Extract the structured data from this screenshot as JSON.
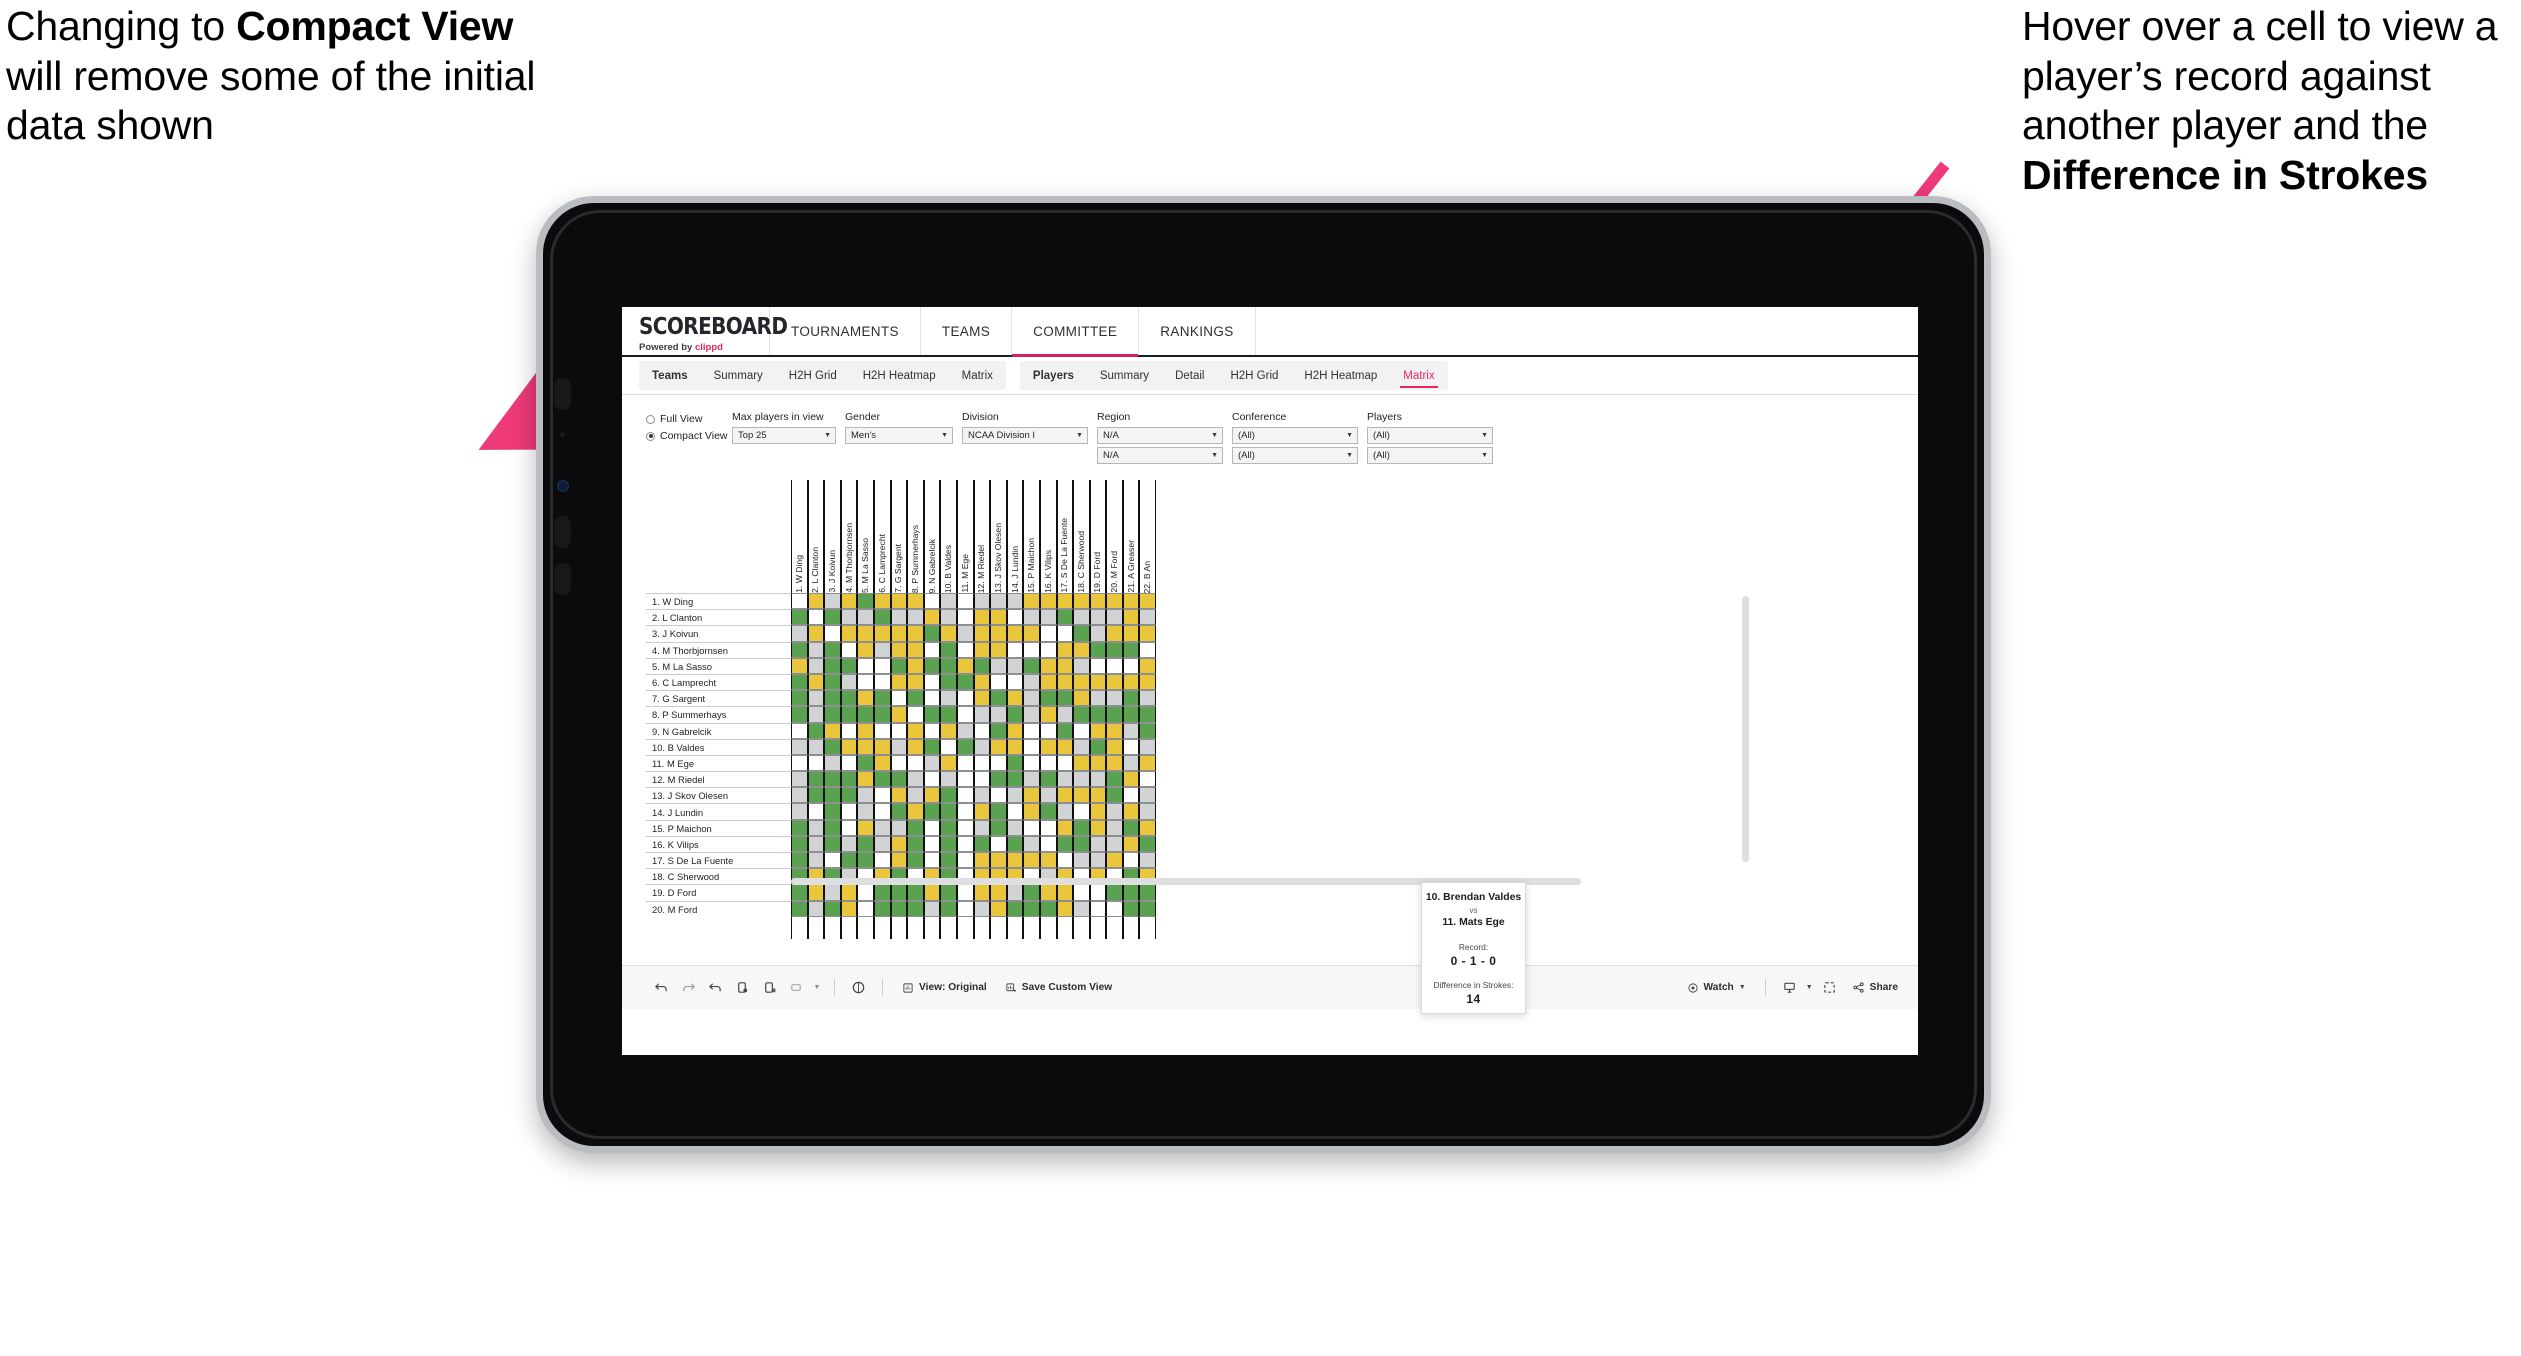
{
  "annotations": {
    "left": {
      "line1": "Changing to ",
      "bold": "Compact View",
      "line2": " will remove some of the initial data shown"
    },
    "right": {
      "line1": "Hover over a cell to view a player’s record against another player and the ",
      "bold": "Difference in Strokes"
    },
    "arrow_color": "#ee3a78"
  },
  "app": {
    "logo": {
      "word": "SCOREBOARD",
      "powered_prefix": "Powered by ",
      "brand": "clippd"
    },
    "top_tabs": [
      {
        "label": "TOURNAMENTS",
        "active": false
      },
      {
        "label": "TEAMS",
        "active": false
      },
      {
        "label": "COMMITTEE",
        "active": true
      },
      {
        "label": "RANKINGS",
        "active": false
      }
    ],
    "sub_tabs_group1": [
      {
        "label": "Teams",
        "active": false,
        "bold": true
      },
      {
        "label": "Summary",
        "active": false,
        "bold": false
      },
      {
        "label": "H2H Grid",
        "active": false,
        "bold": false
      },
      {
        "label": "H2H Heatmap",
        "active": false,
        "bold": false
      },
      {
        "label": "Matrix",
        "active": false,
        "bold": false
      }
    ],
    "sub_tabs_group2": [
      {
        "label": "Players",
        "active": false,
        "bold": true
      },
      {
        "label": "Summary",
        "active": false,
        "bold": false
      },
      {
        "label": "Detail",
        "active": false,
        "bold": false
      },
      {
        "label": "H2H Grid",
        "active": false,
        "bold": false
      },
      {
        "label": "H2H Heatmap",
        "active": false,
        "bold": false
      },
      {
        "label": "Matrix",
        "active": true,
        "bold": false
      }
    ]
  },
  "filters": {
    "view_modes": [
      {
        "label": "Full View",
        "selected": false
      },
      {
        "label": "Compact View",
        "selected": true
      }
    ],
    "fields": [
      {
        "label": "Max players in view",
        "value": "Top 25",
        "second": null
      },
      {
        "label": "Gender",
        "value": "Men's",
        "second": null
      },
      {
        "label": "Division",
        "value": "NCAA Division I",
        "second": null
      },
      {
        "label": "Region",
        "value": "N/A",
        "second": "N/A"
      },
      {
        "label": "Conference",
        "value": "(All)",
        "second": "(All)"
      },
      {
        "label": "Players",
        "value": "(All)",
        "second": "(All)"
      }
    ]
  },
  "tooltip": {
    "player_a": "10. Brendan Valdes",
    "vs": "vs",
    "player_b": "11. Mats Ege",
    "record_label": "Record:",
    "record_value": "0 - 1 - 0",
    "diff_label": "Difference in Strokes:",
    "diff_value": "14"
  },
  "toolbar": {
    "icons": [
      "undo-icon",
      "redo-icon",
      "revert-icon",
      "refresh-data-icon",
      "pause-icon",
      "rectangle-select-icon",
      "dropdown-caret-icon"
    ],
    "help_icon": "help-icon",
    "view_original": "View: Original",
    "save_custom_view": "Save Custom View",
    "watch": "Watch",
    "share": "Share",
    "device_icon": "device-icon",
    "fullscreen_icon": "fullscreen-icon"
  },
  "chart_data": {
    "type": "heatmap",
    "title": "Head-to-Head Player Matrix",
    "legend": {
      "green": "#5aa24f",
      "yellow": "#e9c63c",
      "gray": "#d2d3d5",
      "white": "#ffffff"
    },
    "row_labels": [
      "1. W Ding",
      "2. L Clanton",
      "3. J Koivun",
      "4. M Thorbjornsen",
      "5. M La Sasso",
      "6. C Lamprecht",
      "7. G Sargent",
      "8. P Summerhays",
      "9. N Gabrelcik",
      "10. B Valdes",
      "11. M Ege",
      "12. M Riedel",
      "13. J Skov Olesen",
      "14. J Lundin",
      "15. P Maichon",
      "16. K Vilips",
      "17. S De La Fuente",
      "18. C Sherwood",
      "19. D Ford",
      "20. M Ford"
    ],
    "col_labels": [
      "1. W Ding",
      "2. L Clanton",
      "3. J Koivun",
      "4. M Thorbjornsen",
      "5. M La Sasso",
      "6. C Lamprecht",
      "7. G Sargent",
      "8. P Summerhays",
      "9. N Gabrelcik",
      "10. B Valdes",
      "11. M Ege",
      "12. M Riedel",
      "13. J Skov Olesen",
      "14. J Lundin",
      "15. P Maichon",
      "16. K Vilips",
      "17. S De La Fuente",
      "18. C Sherwood",
      "19. D Ford",
      "20. M Ford",
      "21. A Greaser",
      "22. B An"
    ],
    "cells": [
      [
        "w",
        "y",
        "a",
        "y",
        "g",
        "y",
        "y",
        "y",
        "w",
        "a",
        "w",
        "a",
        "a",
        "a",
        "y",
        "y",
        "y",
        "y",
        "y",
        "y",
        "y",
        "y"
      ],
      [
        "g",
        "w",
        "g",
        "a",
        "a",
        "g",
        "a",
        "a",
        "y",
        "a",
        "w",
        "y",
        "y",
        "w",
        "a",
        "a",
        "g",
        "a",
        "a",
        "a",
        "y",
        "a"
      ],
      [
        "a",
        "y",
        "w",
        "y",
        "y",
        "y",
        "y",
        "y",
        "g",
        "y",
        "a",
        "y",
        "y",
        "y",
        "y",
        "w",
        "w",
        "g",
        "a",
        "y",
        "y",
        "y"
      ],
      [
        "g",
        "a",
        "g",
        "w",
        "y",
        "a",
        "y",
        "y",
        "w",
        "g",
        "w",
        "y",
        "y",
        "w",
        "w",
        "w",
        "y",
        "y",
        "g",
        "g",
        "g",
        "w"
      ],
      [
        "y",
        "a",
        "g",
        "g",
        "w",
        "w",
        "g",
        "y",
        "g",
        "g",
        "y",
        "g",
        "a",
        "a",
        "g",
        "y",
        "y",
        "a",
        "w",
        "w",
        "w",
        "y"
      ],
      [
        "g",
        "y",
        "g",
        "a",
        "w",
        "w",
        "y",
        "y",
        "w",
        "g",
        "g",
        "y",
        "w",
        "w",
        "a",
        "y",
        "y",
        "y",
        "y",
        "y",
        "y",
        "y"
      ],
      [
        "g",
        "a",
        "g",
        "g",
        "y",
        "g",
        "w",
        "g",
        "w",
        "a",
        "w",
        "y",
        "g",
        "y",
        "a",
        "g",
        "g",
        "y",
        "a",
        "a",
        "g",
        "a"
      ],
      [
        "g",
        "a",
        "g",
        "g",
        "g",
        "g",
        "y",
        "w",
        "g",
        "g",
        "w",
        "a",
        "a",
        "g",
        "a",
        "y",
        "a",
        "g",
        "g",
        "g",
        "g",
        "g"
      ],
      [
        "w",
        "g",
        "y",
        "w",
        "y",
        "w",
        "w",
        "y",
        "w",
        "y",
        "a",
        "w",
        "g",
        "y",
        "w",
        "w",
        "g",
        "w",
        "y",
        "y",
        "a",
        "g"
      ],
      [
        "a",
        "a",
        "g",
        "y",
        "y",
        "y",
        "a",
        "y",
        "g",
        "w",
        "g",
        "a",
        "y",
        "y",
        "w",
        "y",
        "y",
        "a",
        "g",
        "y",
        "w",
        "a"
      ],
      [
        "w",
        "w",
        "a",
        "w",
        "g",
        "y",
        "w",
        "w",
        "a",
        "y",
        "w",
        "w",
        "w",
        "g",
        "w",
        "w",
        "w",
        "y",
        "y",
        "y",
        "a",
        "y"
      ],
      [
        "a",
        "g",
        "g",
        "g",
        "y",
        "g",
        "g",
        "a",
        "w",
        "a",
        "w",
        "w",
        "g",
        "g",
        "a",
        "g",
        "a",
        "a",
        "a",
        "g",
        "y",
        "w"
      ],
      [
        "a",
        "g",
        "g",
        "g",
        "a",
        "w",
        "y",
        "a",
        "y",
        "g",
        "w",
        "a",
        "w",
        "a",
        "y",
        "a",
        "y",
        "y",
        "y",
        "g",
        "w",
        "a"
      ],
      [
        "a",
        "w",
        "g",
        "w",
        "a",
        "w",
        "g",
        "y",
        "g",
        "g",
        "w",
        "y",
        "g",
        "w",
        "y",
        "g",
        "a",
        "w",
        "y",
        "a",
        "y",
        "a"
      ],
      [
        "g",
        "a",
        "g",
        "w",
        "y",
        "a",
        "a",
        "g",
        "w",
        "g",
        "w",
        "a",
        "g",
        "a",
        "w",
        "w",
        "y",
        "g",
        "y",
        "a",
        "g",
        "y"
      ],
      [
        "g",
        "a",
        "g",
        "a",
        "g",
        "a",
        "y",
        "g",
        "w",
        "g",
        "w",
        "g",
        "w",
        "g",
        "a",
        "w",
        "g",
        "g",
        "a",
        "a",
        "y",
        "g"
      ],
      [
        "g",
        "a",
        "w",
        "g",
        "g",
        "w",
        "y",
        "g",
        "w",
        "g",
        "w",
        "y",
        "y",
        "y",
        "y",
        "y",
        "w",
        "a",
        "a",
        "y",
        "w",
        "a"
      ],
      [
        "g",
        "y",
        "g",
        "a",
        "w",
        "y",
        "g",
        "w",
        "y",
        "g",
        "w",
        "y",
        "y",
        "y",
        "w",
        "a",
        "y",
        "w",
        "y",
        "w",
        "g",
        "y"
      ],
      [
        "g",
        "y",
        "a",
        "y",
        "w",
        "g",
        "g",
        "g",
        "y",
        "g",
        "w",
        "y",
        "y",
        "a",
        "g",
        "y",
        "y",
        "w",
        "w",
        "g",
        "g",
        "g"
      ],
      [
        "g",
        "a",
        "g",
        "y",
        "w",
        "g",
        "g",
        "g",
        "a",
        "g",
        "w",
        "a",
        "y",
        "g",
        "g",
        "g",
        "y",
        "a",
        "w",
        "w",
        "g",
        "g"
      ]
    ],
    "highlighted": {
      "row": 10,
      "col": 11,
      "note": "hovered cell shown in tooltip"
    }
  }
}
